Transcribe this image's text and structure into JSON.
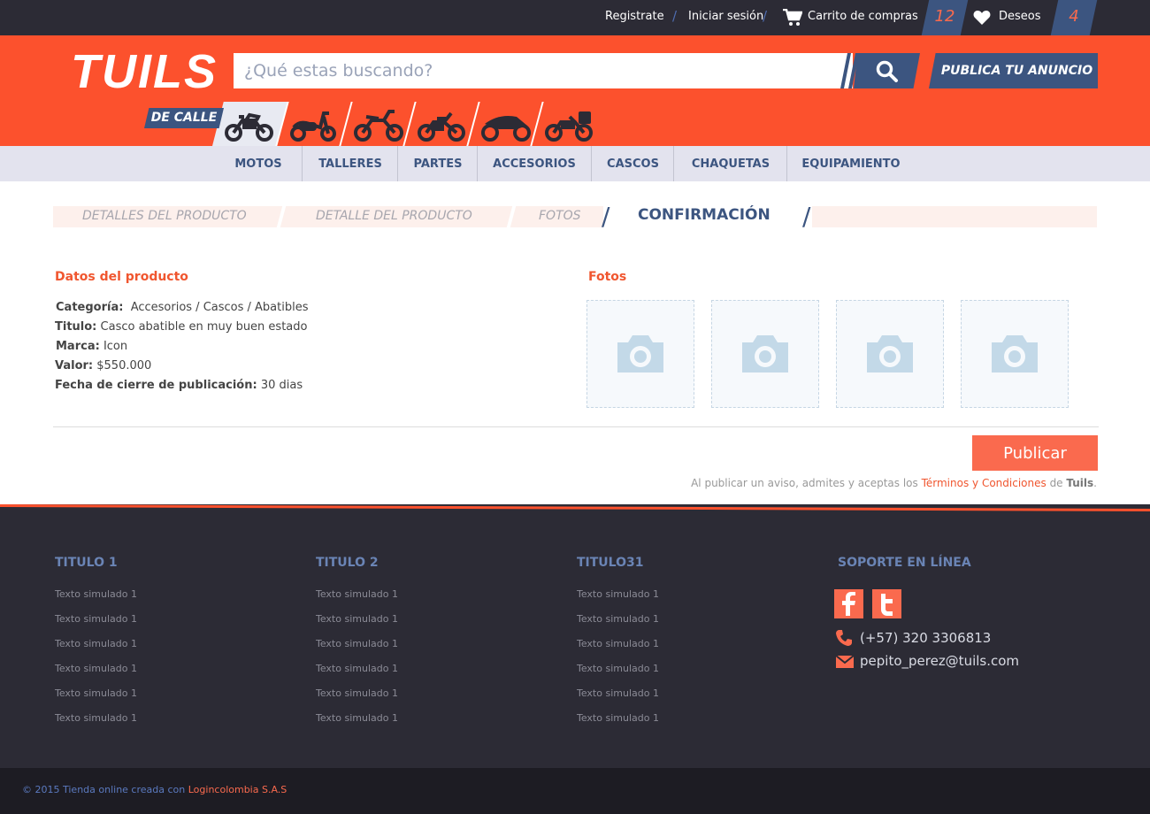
{
  "topbar": {
    "register": "Registrate",
    "login": "Iniciar sesión",
    "cart_label": "Carrito de compras",
    "cart_count": "12",
    "wishlist_label": "Deseos",
    "wishlist_count": "4"
  },
  "header": {
    "logo": "TUILS",
    "search_placeholder": "¿Qué estas buscando?",
    "publish_ad": "PUBLICA TU ANUNCIO",
    "category_active": "DE CALLE",
    "category_icons": [
      "street-motorcycle-icon",
      "scooter-icon",
      "dirt-bike-icon",
      "chopper-icon",
      "sport-bike-icon",
      "touring-bike-icon"
    ]
  },
  "nav": [
    "MOTOS",
    "TALLERES",
    "PARTES",
    "ACCESORIOS",
    "CASCOS",
    "CHAQUETAS",
    "EQUIPAMIENTO"
  ],
  "steps": {
    "step1": "DETALLES DEL PRODUCTO",
    "step2": "DETALLE DEL PRODUCTO",
    "step3": "FOTOS",
    "step4": "CONFIRMACIÓN"
  },
  "product": {
    "title": "Datos del producto",
    "category_label": "Categoría:",
    "category_value": "Accesorios / Cascos / Abatibles",
    "name_label": "Titulo:",
    "name_value": "Casco abatible en muy buen estado",
    "brand_label": "Marca:",
    "brand_value": "Icon",
    "price_label": "Valor:",
    "price_value": "$550.000",
    "closing_label": "Fecha de cierre de publicación:",
    "closing_value": "30 dias"
  },
  "photos": {
    "title": "Fotos"
  },
  "publish": {
    "button": "Publicar",
    "terms_prefix": "Al publicar un aviso, admites y aceptas los",
    "terms_link": "Términos y Condiciones",
    "terms_mid": "de",
    "terms_brand": "Tuils",
    "terms_end": "."
  },
  "footer": {
    "col1": {
      "title": "TITULO 1",
      "links": [
        "Texto simulado 1",
        "Texto simulado 1",
        "Texto simulado 1",
        "Texto simulado 1",
        "Texto simulado 1",
        "Texto simulado 1"
      ]
    },
    "col2": {
      "title": "TITULO 2",
      "links": [
        "Texto simulado 1",
        "Texto simulado 1",
        "Texto simulado 1",
        "Texto simulado 1",
        "Texto simulado 1",
        "Texto simulado 1"
      ]
    },
    "col3": {
      "title": "TITULO31",
      "links": [
        "Texto simulado 1",
        "Texto simulado 1",
        "Texto simulado 1",
        "Texto simulado 1",
        "Texto simulado 1",
        "Texto simulado 1"
      ]
    },
    "support": {
      "title": "SOPORTE EN LÍNEA",
      "phone": "(+57) 320 3306813",
      "email": "pepito_perez@tuils.com"
    },
    "copyright": "© 2015 Tienda online creada con",
    "copyright_link": "Logincolombia S.A.S"
  },
  "colors": {
    "accent": "#fc512d",
    "navy": "#3c5580",
    "footer": "#2c2b35"
  }
}
